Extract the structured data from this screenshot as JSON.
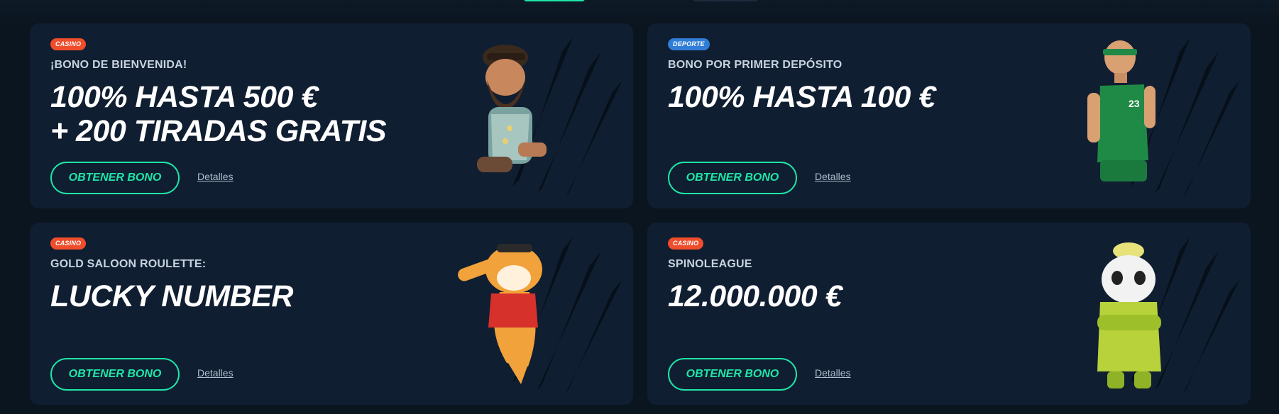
{
  "cards": [
    {
      "badge": "CASINO",
      "subtitle": "¡BONO DE BIENVENIDA!",
      "headline_line1": "100% HASTA 500 €",
      "headline_line2": "+ 200 TIRADAS GRATIS",
      "cta": "OBTENER BONO",
      "details": "Detalles",
      "art_icon": "bearded-dwarf-character-illustration"
    },
    {
      "badge": "DEPORTE",
      "subtitle": "BONO POR PRIMER DEPÓSITO",
      "headline_line1": "100% HASTA 100 €",
      "headline_line2": "",
      "cta": "OBTENER BONO",
      "details": "Detalles",
      "art_icon": "basketball-player-illustration",
      "jersey_number": "23"
    },
    {
      "badge": "CASINO",
      "subtitle": "GOLD SALOON ROULETTE:",
      "headline_line1": "LUCKY NUMBER",
      "headline_line2": "",
      "cta": "OBTENER BONO",
      "details": "Detalles",
      "art_icon": "tiger-character-illustration"
    },
    {
      "badge": "CASINO",
      "subtitle": "SPINOLEAGUE",
      "headline_line1": "12.000.000 €",
      "headline_line2": "",
      "cta": "OBTENER BONO",
      "details": "Detalles",
      "art_icon": "panda-character-illustration"
    }
  ],
  "colors": {
    "accent": "#1fe6a8",
    "casino_badge": "#ef4d2b",
    "sport_badge": "#2f7dd6",
    "card_bg": "#101e31",
    "page_bg": "#0b1520"
  }
}
